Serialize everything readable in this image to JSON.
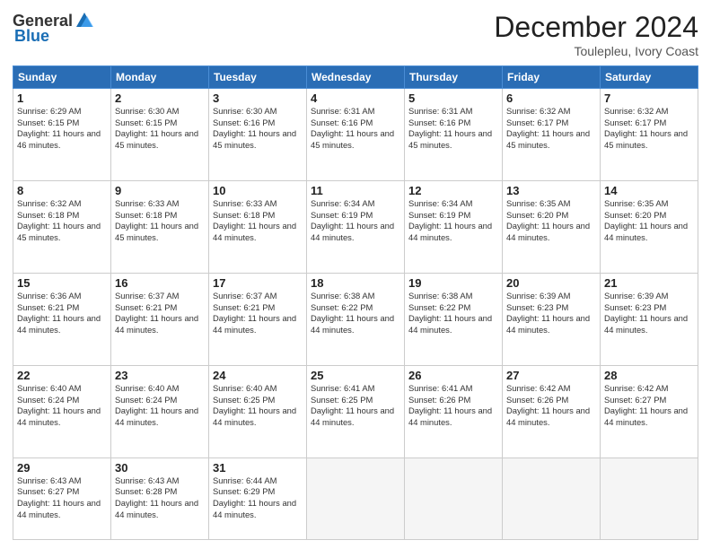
{
  "logo": {
    "general": "General",
    "blue": "Blue"
  },
  "header": {
    "month": "December 2024",
    "location": "Toulepleu, Ivory Coast"
  },
  "days_of_week": [
    "Sunday",
    "Monday",
    "Tuesday",
    "Wednesday",
    "Thursday",
    "Friday",
    "Saturday"
  ],
  "weeks": [
    [
      {
        "day": "1",
        "rise": "6:29 AM",
        "set": "6:15 PM",
        "hours": "11 hours and 46 minutes."
      },
      {
        "day": "2",
        "rise": "6:30 AM",
        "set": "6:15 PM",
        "hours": "11 hours and 45 minutes."
      },
      {
        "day": "3",
        "rise": "6:30 AM",
        "set": "6:16 PM",
        "hours": "11 hours and 45 minutes."
      },
      {
        "day": "4",
        "rise": "6:31 AM",
        "set": "6:16 PM",
        "hours": "11 hours and 45 minutes."
      },
      {
        "day": "5",
        "rise": "6:31 AM",
        "set": "6:16 PM",
        "hours": "11 hours and 45 minutes."
      },
      {
        "day": "6",
        "rise": "6:32 AM",
        "set": "6:17 PM",
        "hours": "11 hours and 45 minutes."
      },
      {
        "day": "7",
        "rise": "6:32 AM",
        "set": "6:17 PM",
        "hours": "11 hours and 45 minutes."
      }
    ],
    [
      {
        "day": "8",
        "rise": "6:32 AM",
        "set": "6:18 PM",
        "hours": "11 hours and 45 minutes."
      },
      {
        "day": "9",
        "rise": "6:33 AM",
        "set": "6:18 PM",
        "hours": "11 hours and 45 minutes."
      },
      {
        "day": "10",
        "rise": "6:33 AM",
        "set": "6:18 PM",
        "hours": "11 hours and 44 minutes."
      },
      {
        "day": "11",
        "rise": "6:34 AM",
        "set": "6:19 PM",
        "hours": "11 hours and 44 minutes."
      },
      {
        "day": "12",
        "rise": "6:34 AM",
        "set": "6:19 PM",
        "hours": "11 hours and 44 minutes."
      },
      {
        "day": "13",
        "rise": "6:35 AM",
        "set": "6:20 PM",
        "hours": "11 hours and 44 minutes."
      },
      {
        "day": "14",
        "rise": "6:35 AM",
        "set": "6:20 PM",
        "hours": "11 hours and 44 minutes."
      }
    ],
    [
      {
        "day": "15",
        "rise": "6:36 AM",
        "set": "6:21 PM",
        "hours": "11 hours and 44 minutes."
      },
      {
        "day": "16",
        "rise": "6:37 AM",
        "set": "6:21 PM",
        "hours": "11 hours and 44 minutes."
      },
      {
        "day": "17",
        "rise": "6:37 AM",
        "set": "6:21 PM",
        "hours": "11 hours and 44 minutes."
      },
      {
        "day": "18",
        "rise": "6:38 AM",
        "set": "6:22 PM",
        "hours": "11 hours and 44 minutes."
      },
      {
        "day": "19",
        "rise": "6:38 AM",
        "set": "6:22 PM",
        "hours": "11 hours and 44 minutes."
      },
      {
        "day": "20",
        "rise": "6:39 AM",
        "set": "6:23 PM",
        "hours": "11 hours and 44 minutes."
      },
      {
        "day": "21",
        "rise": "6:39 AM",
        "set": "6:23 PM",
        "hours": "11 hours and 44 minutes."
      }
    ],
    [
      {
        "day": "22",
        "rise": "6:40 AM",
        "set": "6:24 PM",
        "hours": "11 hours and 44 minutes."
      },
      {
        "day": "23",
        "rise": "6:40 AM",
        "set": "6:24 PM",
        "hours": "11 hours and 44 minutes."
      },
      {
        "day": "24",
        "rise": "6:40 AM",
        "set": "6:25 PM",
        "hours": "11 hours and 44 minutes."
      },
      {
        "day": "25",
        "rise": "6:41 AM",
        "set": "6:25 PM",
        "hours": "11 hours and 44 minutes."
      },
      {
        "day": "26",
        "rise": "6:41 AM",
        "set": "6:26 PM",
        "hours": "11 hours and 44 minutes."
      },
      {
        "day": "27",
        "rise": "6:42 AM",
        "set": "6:26 PM",
        "hours": "11 hours and 44 minutes."
      },
      {
        "day": "28",
        "rise": "6:42 AM",
        "set": "6:27 PM",
        "hours": "11 hours and 44 minutes."
      }
    ],
    [
      {
        "day": "29",
        "rise": "6:43 AM",
        "set": "6:27 PM",
        "hours": "11 hours and 44 minutes."
      },
      {
        "day": "30",
        "rise": "6:43 AM",
        "set": "6:28 PM",
        "hours": "11 hours and 44 minutes."
      },
      {
        "day": "31",
        "rise": "6:44 AM",
        "set": "6:29 PM",
        "hours": "11 hours and 44 minutes."
      },
      null,
      null,
      null,
      null
    ]
  ]
}
